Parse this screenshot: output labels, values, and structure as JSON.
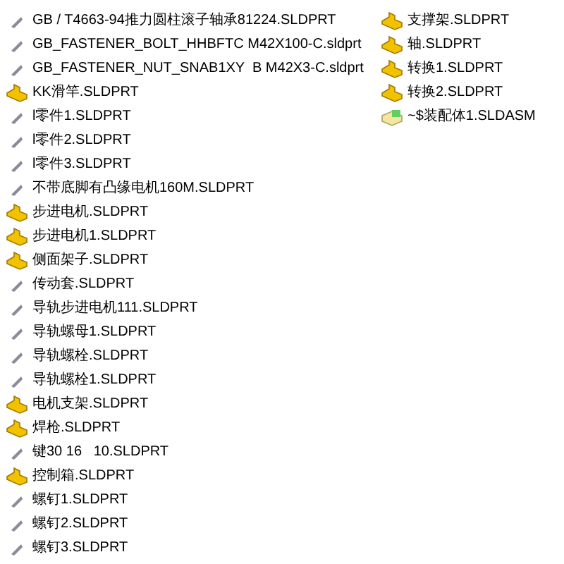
{
  "columns": [
    {
      "files": [
        {
          "name": "GB / T4663-94推力圆柱滚子轴承81224.SLDPRT",
          "kind": "thumbnail"
        },
        {
          "name": "GB_FASTENER_BOLT_HHBFTC M42X100-C.sldprt",
          "kind": "thumbnail"
        },
        {
          "name": "GB_FASTENER_NUT_SNAB1XY  B M42X3-C.sldprt",
          "kind": "thumbnail"
        },
        {
          "name": "KK滑竿.SLDPRT",
          "kind": "part"
        },
        {
          "name": "l零件1.SLDPRT",
          "kind": "thumbnail"
        },
        {
          "name": "l零件2.SLDPRT",
          "kind": "thumbnail"
        },
        {
          "name": "l零件3.SLDPRT",
          "kind": "thumbnail"
        },
        {
          "name": "不带底脚有凸缘电机160M.SLDPRT",
          "kind": "thumbnail"
        },
        {
          "name": "步进电机.SLDPRT",
          "kind": "part"
        },
        {
          "name": "步进电机1.SLDPRT",
          "kind": "part"
        },
        {
          "name": "侧面架子.SLDPRT",
          "kind": "part"
        },
        {
          "name": "传动套.SLDPRT",
          "kind": "thumbnail"
        },
        {
          "name": "导轨步进电机111.SLDPRT",
          "kind": "thumbnail"
        },
        {
          "name": "导轨螺母1.SLDPRT",
          "kind": "thumbnail"
        },
        {
          "name": "导轨螺栓.SLDPRT",
          "kind": "thumbnail"
        },
        {
          "name": "导轨螺栓1.SLDPRT",
          "kind": "thumbnail"
        },
        {
          "name": "电机支架.SLDPRT",
          "kind": "part"
        },
        {
          "name": "焊枪.SLDPRT",
          "kind": "part"
        },
        {
          "name": "键30 16   10.SLDPRT",
          "kind": "thumbnail"
        },
        {
          "name": "控制箱.SLDPRT",
          "kind": "part"
        },
        {
          "name": "螺钉1.SLDPRT",
          "kind": "thumbnail"
        },
        {
          "name": "螺钉2.SLDPRT",
          "kind": "thumbnail"
        },
        {
          "name": "螺钉3.SLDPRT",
          "kind": "thumbnail"
        }
      ]
    },
    {
      "files": [
        {
          "name": "支撑架.SLDPRT",
          "kind": "part"
        },
        {
          "name": "轴.SLDPRT",
          "kind": "part"
        },
        {
          "name": "转换1.SLDPRT",
          "kind": "part"
        },
        {
          "name": "转换2.SLDPRT",
          "kind": "part"
        },
        {
          "name": "~$装配体1.SLDASM",
          "kind": "assembly"
        }
      ]
    }
  ]
}
